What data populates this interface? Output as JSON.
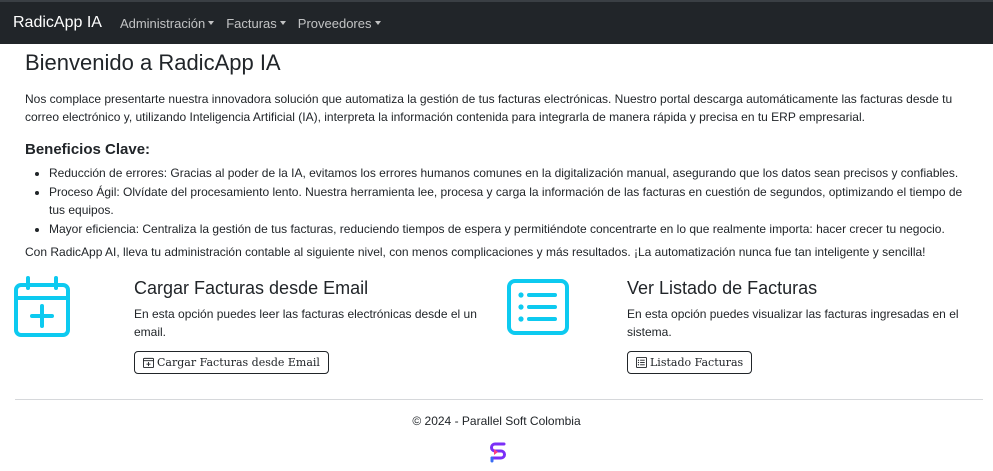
{
  "navbar": {
    "brand": "RadicApp IA",
    "items": [
      {
        "label": "Administración"
      },
      {
        "label": "Facturas"
      },
      {
        "label": "Proveedores"
      }
    ]
  },
  "main": {
    "title": "Bienvenido a RadicApp IA",
    "intro": "Nos complace presentarte nuestra innovadora solución que automatiza la gestión de tus facturas electrónicas. Nuestro portal descarga automáticamente las facturas desde tu correo electrónico y, utilizando Inteligencia Artificial (IA), interpreta la información contenida para integrarla de manera rápida y precisa en tu ERP empresarial.",
    "benefits_title": "Beneficios Clave:",
    "benefits": [
      "Reducción de errores: Gracias al poder de la IA, evitamos los errores humanos comunes en la digitalización manual, asegurando que los datos sean precisos y confiables.",
      "Proceso Ágil: Olvídate del procesamiento lento. Nuestra herramienta lee, procesa y carga la información de las facturas en cuestión de segundos, optimizando el tiempo de tus equipos.",
      "Mayor eficiencia: Centraliza la gestión de tus facturas, reduciendo tiempos de espera y permitiéndote concentrarte en lo que realmente importa: hacer crecer tu negocio."
    ],
    "closing": "Con RadicApp AI, lleva tu administración contable al siguiente nivel, con menos complicaciones y más resultados. ¡La automatización nunca fue tan inteligente y sencilla!"
  },
  "cards": {
    "email": {
      "icon": "calendar-plus-icon",
      "title": "Cargar Facturas desde Email",
      "text": "En esta opción puedes leer las facturas electrónicas desde el un email.",
      "button_label": "Cargar Facturas desde Email",
      "button_icon": "calendar-plus-icon"
    },
    "list": {
      "icon": "list-icon",
      "title": "Ver Listado de Facturas",
      "text": "En esta opción puedes visualizar las facturas ingresadas en el sistema.",
      "button_label": "Listado Facturas",
      "button_icon": "list-icon"
    }
  },
  "footer": {
    "copyright": "© 2024 - Parallel Soft Colombia",
    "logo_icon": "parallel-soft-logo"
  },
  "colors": {
    "navbar_bg": "#212529",
    "accent": "#0dcaf0",
    "text": "#212529"
  }
}
